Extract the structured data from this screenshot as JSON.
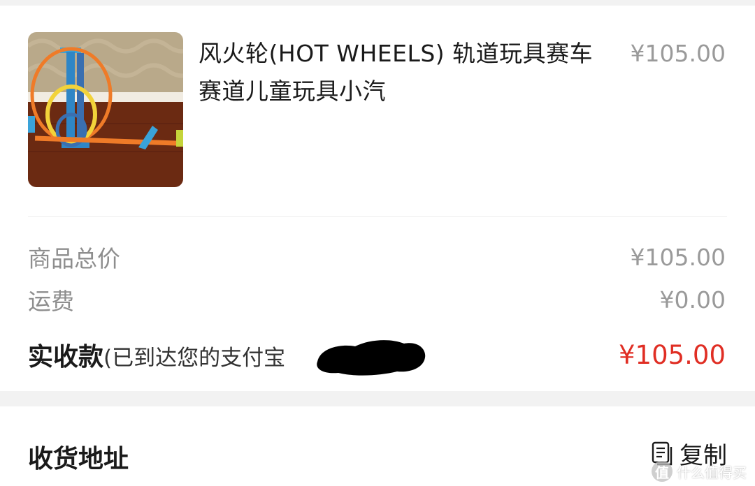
{
  "product": {
    "image_alt": "product-photo",
    "title": "风火轮(HOT WHEELS) 轨道玩具赛车赛道儿童玩具小汽",
    "price": "¥105.00"
  },
  "summary": {
    "subtotal_label": "商品总价",
    "subtotal_value": "¥105.00",
    "shipping_label": "运费",
    "shipping_value": "¥0.00",
    "received_label": "实收款",
    "received_note": "(已到达您的支付宝",
    "received_note_close": ")",
    "received_value": "¥105.00"
  },
  "address": {
    "title": "收货地址",
    "copy_label": "复制"
  },
  "watermark": {
    "mark": "值",
    "text": "什么值得买"
  },
  "colors": {
    "accent_red": "#e02e24",
    "muted_text": "#9a9a9a",
    "primary_text": "#1a1a1a"
  },
  "icons": {
    "copy": "copy-icon"
  }
}
